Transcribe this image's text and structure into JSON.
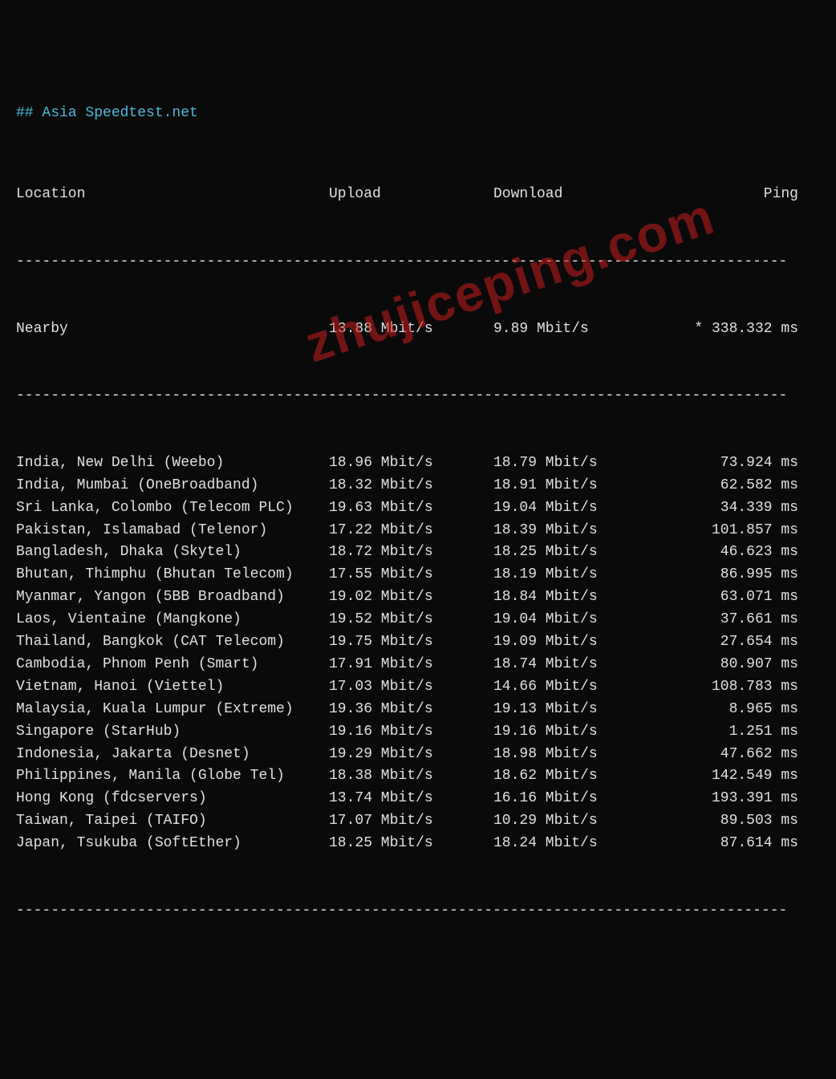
{
  "title_prefix": "## ",
  "title": "Asia Speedtest.net",
  "columns": {
    "location": "Location",
    "upload": "Upload",
    "download": "Download",
    "ping": "Ping"
  },
  "unit_speed": "Mbit/s",
  "unit_ping": "ms",
  "nearby": {
    "location": "Nearby",
    "upload": "13.88",
    "download": "9.89",
    "ping": "338.332",
    "marker": "*"
  },
  "rows": [
    {
      "location": "India, New Delhi (Weebo)",
      "upload": "18.96",
      "download": "18.79",
      "ping": "73.924"
    },
    {
      "location": "India, Mumbai (OneBroadband)",
      "upload": "18.32",
      "download": "18.91",
      "ping": "62.582"
    },
    {
      "location": "Sri Lanka, Colombo (Telecom PLC)",
      "upload": "19.63",
      "download": "19.04",
      "ping": "34.339"
    },
    {
      "location": "Pakistan, Islamabad (Telenor)",
      "upload": "17.22",
      "download": "18.39",
      "ping": "101.857"
    },
    {
      "location": "Bangladesh, Dhaka (Skytel)",
      "upload": "18.72",
      "download": "18.25",
      "ping": "46.623"
    },
    {
      "location": "Bhutan, Thimphu (Bhutan Telecom)",
      "upload": "17.55",
      "download": "18.19",
      "ping": "86.995"
    },
    {
      "location": "Myanmar, Yangon (5BB Broadband)",
      "upload": "19.02",
      "download": "18.84",
      "ping": "63.071"
    },
    {
      "location": "Laos, Vientaine (Mangkone)",
      "upload": "19.52",
      "download": "19.04",
      "ping": "37.661"
    },
    {
      "location": "Thailand, Bangkok (CAT Telecom)",
      "upload": "19.75",
      "download": "19.09",
      "ping": "27.654"
    },
    {
      "location": "Cambodia, Phnom Penh (Smart)",
      "upload": "17.91",
      "download": "18.74",
      "ping": "80.907"
    },
    {
      "location": "Vietnam, Hanoi (Viettel)",
      "upload": "17.03",
      "download": "14.66",
      "ping": "108.783"
    },
    {
      "location": "Malaysia, Kuala Lumpur (Extreme)",
      "upload": "19.36",
      "download": "19.13",
      "ping": "8.965"
    },
    {
      "location": "Singapore (StarHub)",
      "upload": "19.16",
      "download": "19.16",
      "ping": "1.251"
    },
    {
      "location": "Indonesia, Jakarta (Desnet)",
      "upload": "19.29",
      "download": "18.98",
      "ping": "47.662"
    },
    {
      "location": "Philippines, Manila (Globe Tel)",
      "upload": "18.38",
      "download": "18.62",
      "ping": "142.549"
    },
    {
      "location": "Hong Kong (fdcservers)",
      "upload": "13.74",
      "download": "16.16",
      "ping": "193.391"
    },
    {
      "location": "Taiwan, Taipei (TAIFO)",
      "upload": "17.07",
      "download": "10.29",
      "ping": "89.503"
    },
    {
      "location": "Japan, Tsukuba (SoftEther)",
      "upload": "18.25",
      "download": "18.24",
      "ping": "87.614"
    }
  ],
  "watermark": "zhujiceping.com",
  "divider": "-----------------------------------------------------------------------------------------"
}
